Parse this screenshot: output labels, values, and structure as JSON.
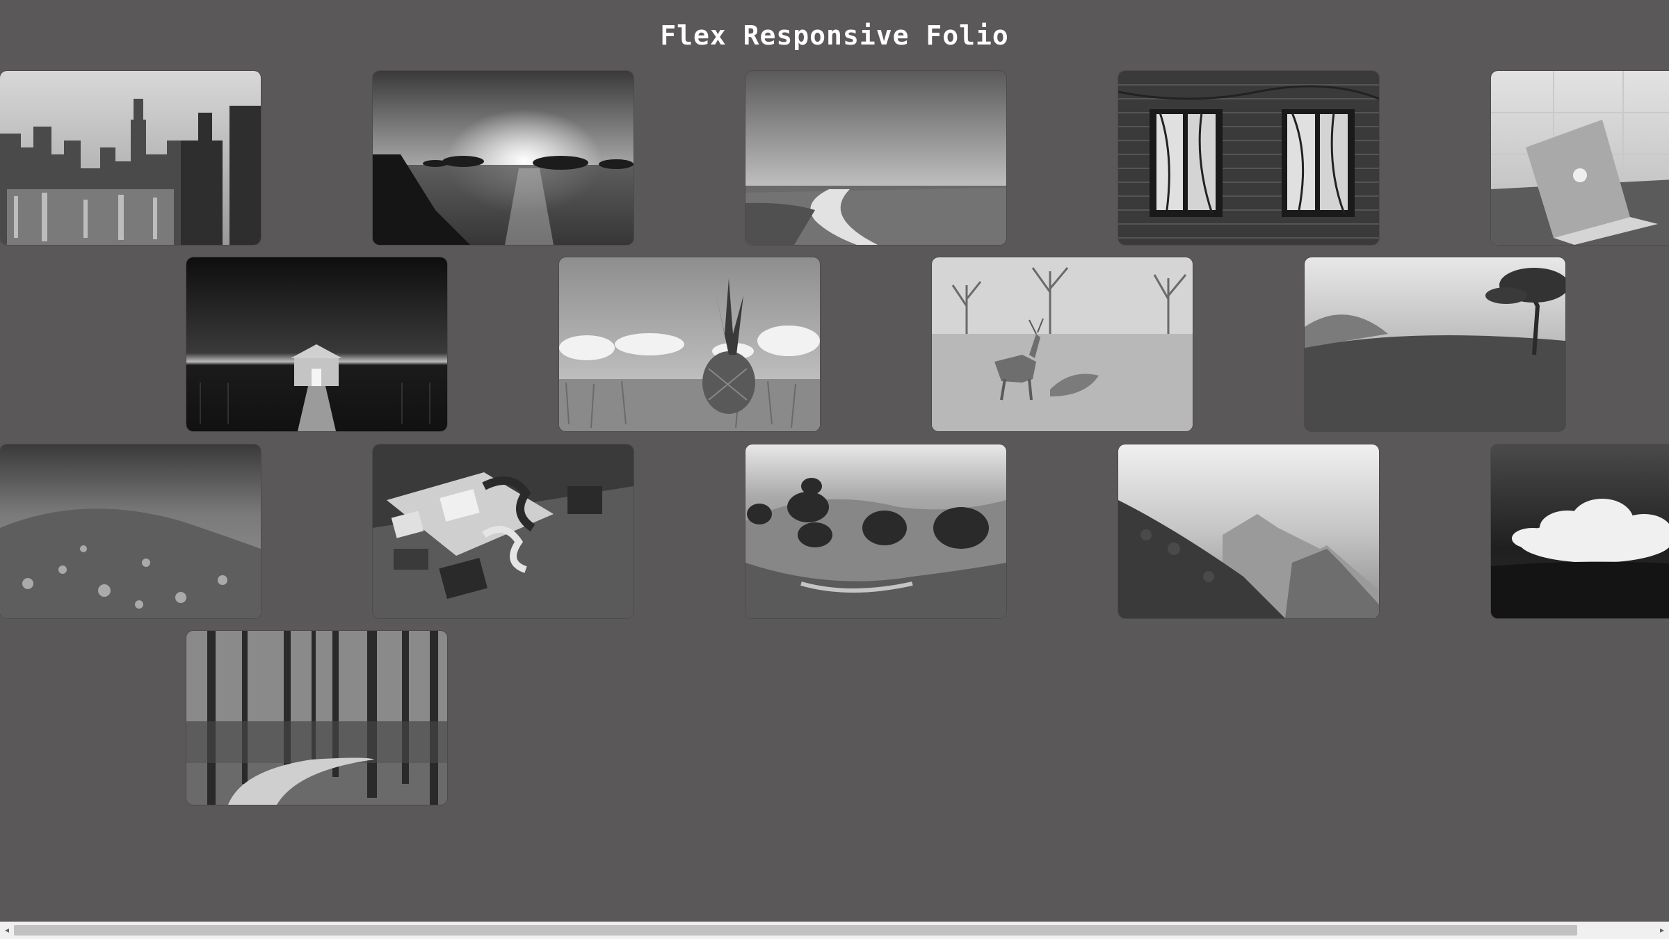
{
  "page": {
    "title": "Flex Responsive Folio"
  },
  "gallery": {
    "images": [
      {
        "name": "city-skyline-photo"
      },
      {
        "name": "ocean-sunset-photo"
      },
      {
        "name": "field-path-photo"
      },
      {
        "name": "ivy-brick-windows-photo"
      },
      {
        "name": "laptop-table-photo"
      },
      {
        "name": "boathouse-pier-photo"
      },
      {
        "name": "pineapple-field-photo"
      },
      {
        "name": "deer-meadow-photo"
      },
      {
        "name": "foggy-hill-tree-photo"
      },
      {
        "name": "forest-hill-photo"
      },
      {
        "name": "letterpress-desk-photo"
      },
      {
        "name": "rolling-hills-trees-photo"
      },
      {
        "name": "mountain-valley-photo"
      },
      {
        "name": "storm-cloud-photo"
      },
      {
        "name": "forest-road-photo"
      }
    ]
  },
  "scrollbar": {
    "left_arrow": "◂",
    "right_arrow": "▸"
  }
}
